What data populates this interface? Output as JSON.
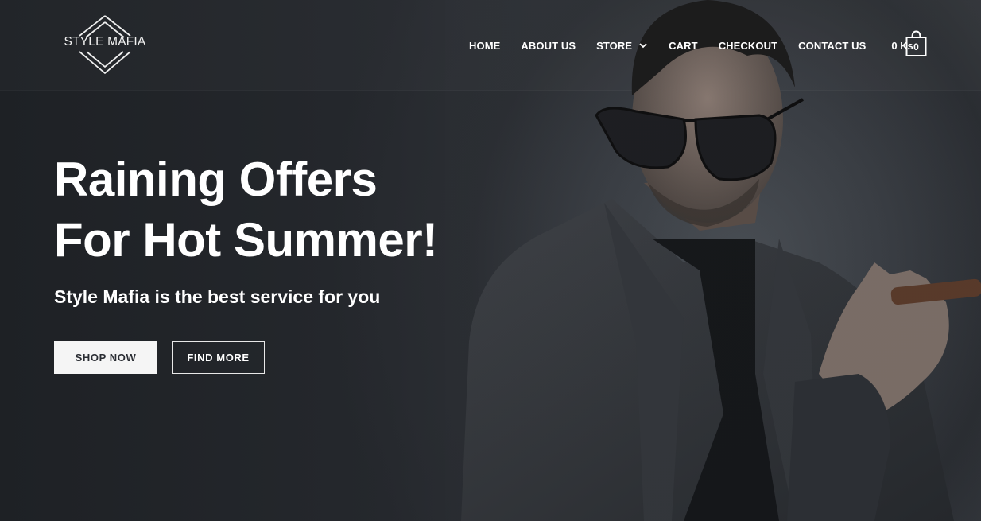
{
  "brand": {
    "logo_text": "STYLE MAFIA"
  },
  "nav": {
    "items": [
      {
        "label": "HOME"
      },
      {
        "label": "ABOUT US"
      },
      {
        "label": "STORE"
      },
      {
        "label": "CART"
      },
      {
        "label": "CHECKOUT"
      },
      {
        "label": "CONTACT US"
      }
    ],
    "cart_total": "0 Ks",
    "cart_count": "0"
  },
  "hero": {
    "headline_line1": "Raining Offers",
    "headline_line2": "For Hot Summer!",
    "subheadline": "Style Mafia is the best service for you",
    "primary_button": "SHOP NOW",
    "secondary_button": "FIND MORE"
  },
  "icons": {
    "logo": "diamond-chevron-logo-icon",
    "store_dropdown": "chevron-down-icon",
    "cart": "shopping-bag-icon"
  }
}
